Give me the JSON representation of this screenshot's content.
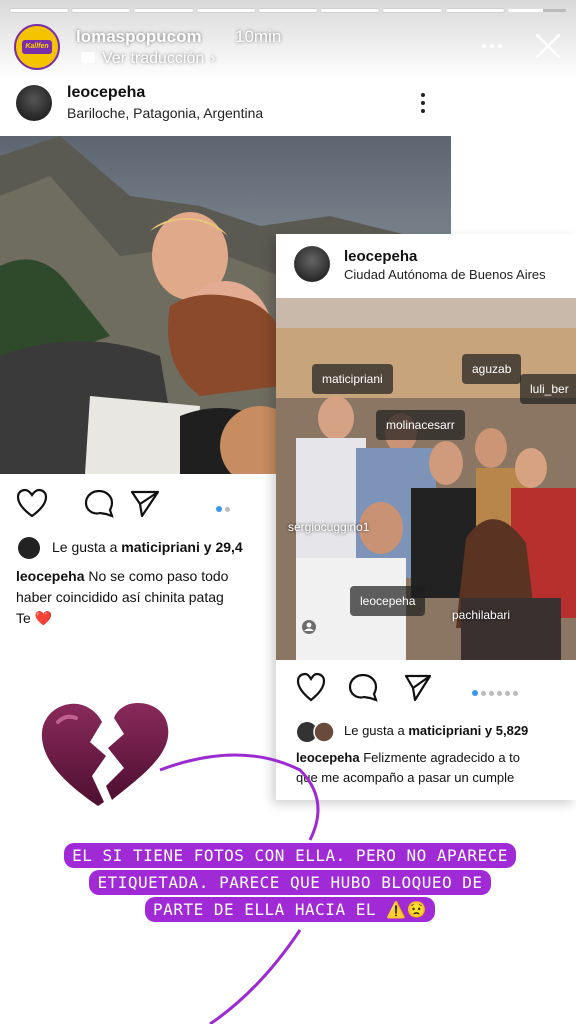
{
  "story": {
    "account": "lomaspopucom",
    "time": "10min",
    "translate": "Ver traducción",
    "avatar_text": "Kallfen",
    "progress_segments": 9,
    "progress_current": 9
  },
  "post1": {
    "user": "leocepeha",
    "location": "Bariloche, Patagonia, Argentina",
    "likes_prefix": "Le gusta a ",
    "likes_user": "maticipriani",
    "likes_suffix": " y 29,4",
    "caption_user": "leocepeha",
    "caption_line1": " No se como paso todo",
    "caption_line2": "haber coincidido así chinita patag",
    "caption_line3": "Te ❤️"
  },
  "post2": {
    "user": "leocepeha",
    "location": "Ciudad Autónoma de Buenos Aires",
    "tags": [
      "maticipriani",
      "aguzab",
      "luli_ber",
      "molinacesarr",
      "sergiocuggino1",
      "leocepeha",
      "pachilabari"
    ],
    "likes_prefix": "Le gusta a ",
    "likes_user": "maticipriani",
    "likes_suffix": " y 5,829",
    "caption_user": "leocepeha",
    "caption_line1": " Felizmente agradecido a to",
    "caption_line2": "que me acompaño a pasar un cumple"
  },
  "banner": {
    "line1": "EL SI TIENE FOTOS CON ELLA. PERO NO APARECE",
    "line2": "ETIQUETADA. PARECE QUE HUBO BLOQUEO DE",
    "line3": "PARTE DE ELLA HACIA EL ⚠️😟"
  },
  "colors": {
    "accent": "#a02bd6",
    "heart": "#6b1a45",
    "like_blue": "#3897f0"
  },
  "icons": [
    "more-icon",
    "close-icon",
    "translate-icon",
    "heart-icon",
    "comment-icon",
    "share-icon",
    "broken-heart-icon",
    "person-tag-icon"
  ]
}
